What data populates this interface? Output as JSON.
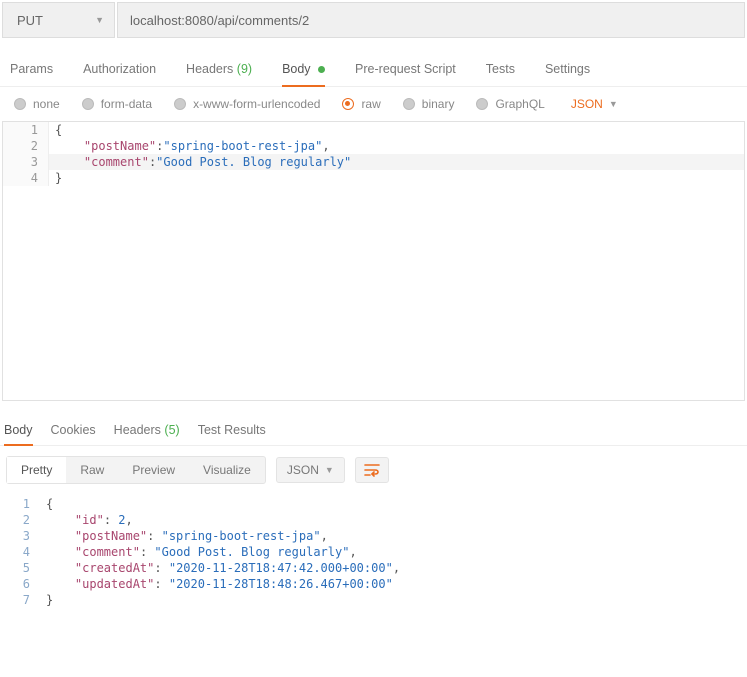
{
  "request": {
    "method": "PUT",
    "url": "localhost:8080/api/comments/2"
  },
  "tabs": {
    "params": "Params",
    "authorization": "Authorization",
    "headers": "Headers",
    "headers_count": "(9)",
    "body": "Body",
    "prerequest": "Pre-request Script",
    "tests": "Tests",
    "settings": "Settings"
  },
  "body_types": {
    "none": "none",
    "formdata": "form-data",
    "xwww": "x-www-form-urlencoded",
    "raw": "raw",
    "binary": "binary",
    "graphql": "GraphQL",
    "format": "JSON"
  },
  "req_body": {
    "l1": "{",
    "l2_key": "\"postName\"",
    "l2_val": "\"spring-boot-rest-jpa\"",
    "l3_key": "\"comment\"",
    "l3_val": "\"Good Post. Blog regularly\"",
    "l4": "}"
  },
  "resp_tabs": {
    "body": "Body",
    "cookies": "Cookies",
    "headers": "Headers",
    "headers_count": "(5)",
    "testresults": "Test Results"
  },
  "resp_toolbar": {
    "pretty": "Pretty",
    "raw": "Raw",
    "preview": "Preview",
    "visualize": "Visualize",
    "format": "JSON"
  },
  "resp_body": {
    "l1": "{",
    "l2_k": "\"id\"",
    "l2_v": "2",
    "l3_k": "\"postName\"",
    "l3_v": "\"spring-boot-rest-jpa\"",
    "l4_k": "\"comment\"",
    "l4_v": "\"Good Post. Blog regularly\"",
    "l5_k": "\"createdAt\"",
    "l5_v": "\"2020-11-28T18:47:42.000+00:00\"",
    "l6_k": "\"updatedAt\"",
    "l6_v": "\"2020-11-28T18:48:26.467+00:00\"",
    "l7": "}"
  },
  "lines": {
    "n1": "1",
    "n2": "2",
    "n3": "3",
    "n4": "4",
    "n5": "5",
    "n6": "6",
    "n7": "7"
  }
}
